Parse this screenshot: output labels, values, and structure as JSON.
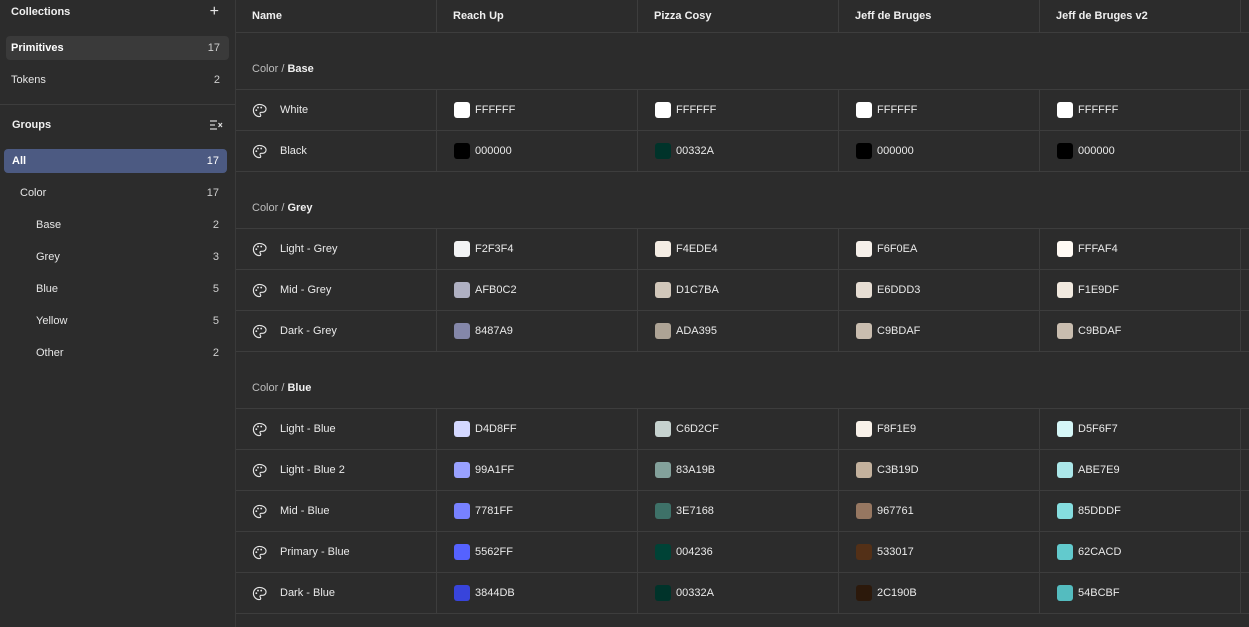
{
  "sidebar": {
    "collections_title": "Collections",
    "collections": [
      {
        "label": "Primitives",
        "count": "17",
        "active": true
      },
      {
        "label": "Tokens",
        "count": "2",
        "active": false
      }
    ],
    "groups_title": "Groups",
    "groups": [
      {
        "label": "All",
        "count": "17",
        "active": true,
        "level": 0
      },
      {
        "label": "Color",
        "count": "17",
        "active": false,
        "level": 1
      },
      {
        "label": "Base",
        "count": "2",
        "active": false,
        "level": 2
      },
      {
        "label": "Grey",
        "count": "3",
        "active": false,
        "level": 2
      },
      {
        "label": "Blue",
        "count": "5",
        "active": false,
        "level": 2
      },
      {
        "label": "Yellow",
        "count": "5",
        "active": false,
        "level": 2
      },
      {
        "label": "Other",
        "count": "2",
        "active": false,
        "level": 2
      }
    ]
  },
  "table": {
    "columns": [
      "Name",
      "Reach Up",
      "Pizza Cosy",
      "Jeff de Bruges",
      "Jeff de Bruges v2"
    ],
    "groups": [
      {
        "prefix": "Color / ",
        "name": "Base",
        "rows": [
          {
            "name": "White",
            "values": [
              "FFFFFF",
              "FFFFFF",
              "FFFFFF",
              "FFFFFF"
            ]
          },
          {
            "name": "Black",
            "values": [
              "000000",
              "00332A",
              "000000",
              "000000"
            ]
          }
        ]
      },
      {
        "prefix": "Color / ",
        "name": "Grey",
        "rows": [
          {
            "name": "Light - Grey",
            "values": [
              "F2F3F4",
              "F4EDE4",
              "F6F0EA",
              "FFFAF4"
            ]
          },
          {
            "name": "Mid - Grey",
            "values": [
              "AFB0C2",
              "D1C7BA",
              "E6DDD3",
              "F1E9DF"
            ]
          },
          {
            "name": "Dark - Grey",
            "values": [
              "8487A9",
              "ADA395",
              "C9BDAF",
              "C9BDAF"
            ]
          }
        ]
      },
      {
        "prefix": "Color / ",
        "name": "Blue",
        "rows": [
          {
            "name": "Light - Blue",
            "values": [
              "D4D8FF",
              "C6D2CF",
              "F8F1E9",
              "D5F6F7"
            ]
          },
          {
            "name": "Light - Blue 2",
            "values": [
              "99A1FF",
              "83A19B",
              "C3B19D",
              "ABE7E9"
            ]
          },
          {
            "name": "Mid - Blue",
            "values": [
              "7781FF",
              "3E7168",
              "967761",
              "85DDDF"
            ]
          },
          {
            "name": "Primary - Blue",
            "values": [
              "5562FF",
              "004236",
              "533017",
              "62CACD"
            ]
          },
          {
            "name": "Dark - Blue",
            "values": [
              "3844DB",
              "00332A",
              "2C190B",
              "54BCBF"
            ]
          }
        ]
      }
    ]
  }
}
